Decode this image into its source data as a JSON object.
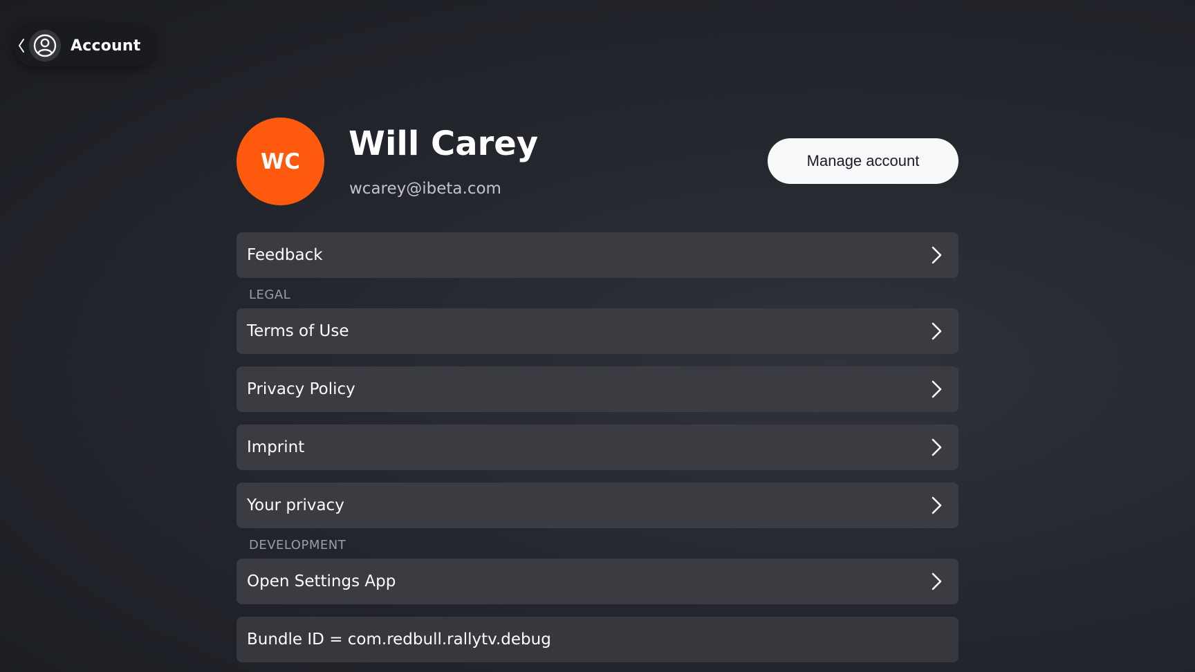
{
  "topbar": {
    "title": "Account"
  },
  "profile": {
    "initials": "WC",
    "name": "Will Carey",
    "email": "wcarey@ibeta.com",
    "manage_label": "Manage account",
    "avatar_color": "#ff5a0e"
  },
  "menu": {
    "feedback": "Feedback",
    "legal_header": "LEGAL",
    "legal_items": [
      "Terms of Use",
      "Privacy Policy",
      "Imprint",
      "Your privacy"
    ],
    "development_header": "DEVELOPMENT",
    "open_settings": "Open Settings App",
    "bundle_id": "Bundle ID = com.redbull.rallytv.debug"
  }
}
